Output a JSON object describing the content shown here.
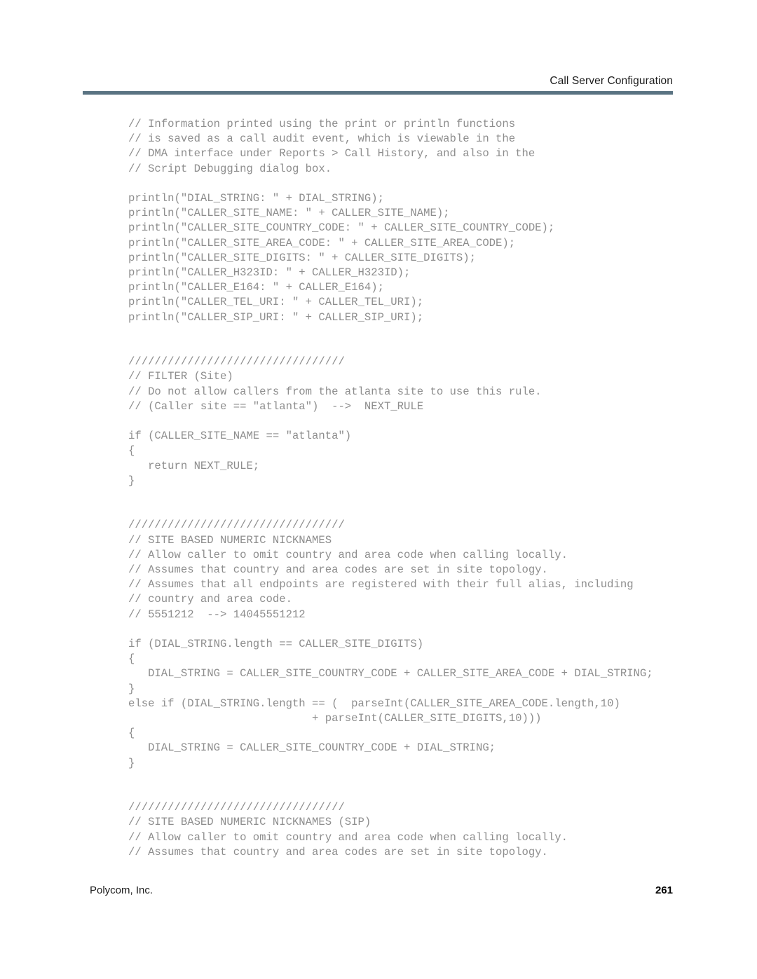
{
  "header": {
    "title": "Call Server Configuration",
    "rule_color": "#5a7382"
  },
  "footer": {
    "company": "Polycom, Inc.",
    "page_number": "261"
  },
  "code": {
    "text_color": "#8d8d8d",
    "lines": [
      "// Information printed using the print or println functions",
      "// is saved as a call audit event, which is viewable in the",
      "// DMA interface under Reports > Call History, and also in the",
      "// Script Debugging dialog box.",
      "",
      "println(\"DIAL_STRING: \" + DIAL_STRING);",
      "println(\"CALLER_SITE_NAME: \" + CALLER_SITE_NAME);",
      "println(\"CALLER_SITE_COUNTRY_CODE: \" + CALLER_SITE_COUNTRY_CODE);",
      "println(\"CALLER_SITE_AREA_CODE: \" + CALLER_SITE_AREA_CODE);",
      "println(\"CALLER_SITE_DIGITS: \" + CALLER_SITE_DIGITS);",
      "println(\"CALLER_H323ID: \" + CALLER_H323ID);",
      "println(\"CALLER_E164: \" + CALLER_E164);",
      "println(\"CALLER_TEL_URI: \" + CALLER_TEL_URI);",
      "println(\"CALLER_SIP_URI: \" + CALLER_SIP_URI);",
      "",
      "",
      "/////////////////////////////////",
      "// FILTER (Site)",
      "// Do not allow callers from the atlanta site to use this rule.",
      "// (Caller site == \"atlanta\")  -->  NEXT_RULE",
      "",
      "if (CALLER_SITE_NAME == \"atlanta\")",
      "{",
      "   return NEXT_RULE;",
      "}",
      "",
      "",
      "/////////////////////////////////",
      "// SITE BASED NUMERIC NICKNAMES",
      "// Allow caller to omit country and area code when calling locally.",
      "// Assumes that country and area codes are set in site topology.",
      "// Assumes that all endpoints are registered with their full alias, including",
      "// country and area code.",
      "// 5551212  --> 14045551212",
      "",
      "if (DIAL_STRING.length == CALLER_SITE_DIGITS)",
      "{",
      "   DIAL_STRING = CALLER_SITE_COUNTRY_CODE + CALLER_SITE_AREA_CODE + DIAL_STRING;",
      "}",
      "else if (DIAL_STRING.length == (  parseInt(CALLER_SITE_AREA_CODE.length,10)",
      "                            + parseInt(CALLER_SITE_DIGITS,10)))",
      "{",
      "   DIAL_STRING = CALLER_SITE_COUNTRY_CODE + DIAL_STRING;",
      "}",
      "",
      "",
      "/////////////////////////////////",
      "// SITE BASED NUMERIC NICKNAMES (SIP)",
      "// Allow caller to omit country and area code when calling locally.",
      "// Assumes that country and area codes are set in site topology."
    ]
  }
}
